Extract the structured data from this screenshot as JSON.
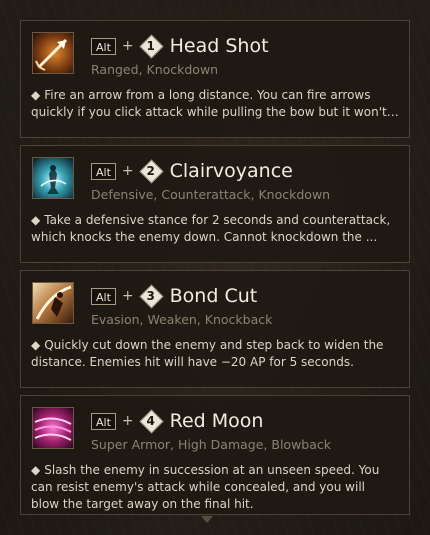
{
  "skills": [
    {
      "key": "Alt",
      "plus": "+",
      "mouse": "1",
      "name": "Head Shot",
      "tags": "Ranged, Knockdown",
      "bullet": "◆",
      "desc_line1": "Fire an arrow from a long distance. You can fire arrows",
      "desc_line2": "quickly if you click attack while pulling the bow but it won't ...",
      "desc_line3": "",
      "icon": "arrow-skill-icon"
    },
    {
      "key": "Alt",
      "plus": "+",
      "mouse": "2",
      "name": "Clairvoyance",
      "tags": "Defensive, Counterattack, Knockdown",
      "bullet": "◆",
      "desc_line1": "Take a defensive stance for 2 seconds and counterattack,",
      "desc_line2": "which knocks the enemy down. Cannot knockdown the ...",
      "desc_line3": "",
      "icon": "stance-skill-icon"
    },
    {
      "key": "Alt",
      "plus": "+",
      "mouse": "3",
      "name": "Bond Cut",
      "tags": "Evasion, Weaken, Knockback",
      "bullet": "◆",
      "desc_line1": "Quickly cut down the enemy and step back to widen the",
      "desc_line2": "distance. Enemies hit will have −20 AP for 5 seconds.",
      "desc_line3": "",
      "icon": "slash-skill-icon"
    },
    {
      "key": "Alt",
      "plus": "+",
      "mouse": "4",
      "name": "Red Moon",
      "tags": "Super Armor, High Damage, Blowback",
      "bullet": "◆",
      "desc_line1": "Slash the enemy in succession at an unseen speed. You",
      "desc_line2": "can resist enemy's attack while concealed, and you will",
      "desc_line3": "blow the target away on the final hit.",
      "icon": "red-moon-skill-icon"
    }
  ]
}
